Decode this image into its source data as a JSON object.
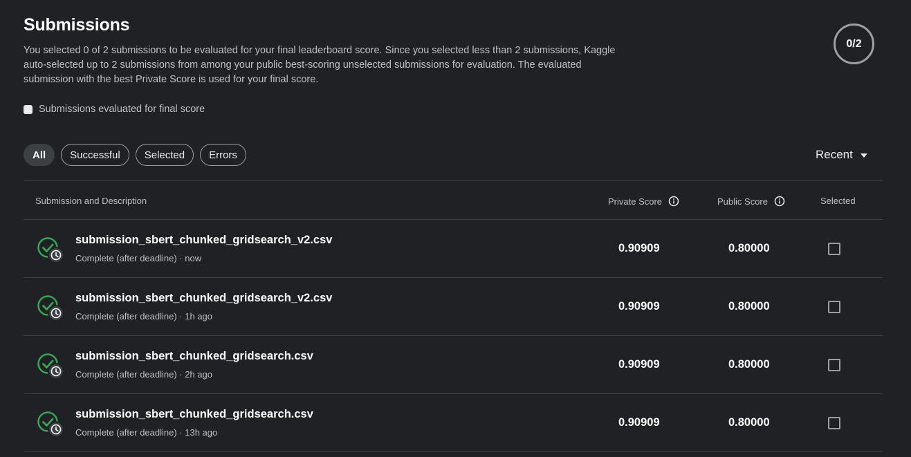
{
  "header": {
    "title": "Submissions",
    "description": "You selected 0 of 2 submissions to be evaluated for your final leaderboard score. Since you selected less than 2 submissions, Kaggle auto-selected up to 2 submissions from among your public best-scoring unselected submissions for evaluation. The evaluated submission with the best Private Score is used for your final score.",
    "counter": "0/2"
  },
  "legend": {
    "label": "Submissions evaluated for final score"
  },
  "filters": {
    "chips": [
      "All",
      "Successful",
      "Selected",
      "Errors"
    ],
    "active": "All"
  },
  "sort": {
    "label": "Recent"
  },
  "table": {
    "columns": {
      "submission": "Submission and Description",
      "private": "Private Score",
      "public": "Public Score",
      "selected": "Selected"
    },
    "rows": [
      {
        "filename": "submission_sbert_chunked_gridsearch_v2.csv",
        "status": "Complete (after deadline) · now",
        "private_score": "0.90909",
        "public_score": "0.80000",
        "selected": false
      },
      {
        "filename": "submission_sbert_chunked_gridsearch_v2.csv",
        "status": "Complete (after deadline) · 1h ago",
        "private_score": "0.90909",
        "public_score": "0.80000",
        "selected": false
      },
      {
        "filename": "submission_sbert_chunked_gridsearch.csv",
        "status": "Complete (after deadline) · 2h ago",
        "private_score": "0.90909",
        "public_score": "0.80000",
        "selected": false
      },
      {
        "filename": "submission_sbert_chunked_gridsearch.csv",
        "status": "Complete (after deadline) · 13h ago",
        "private_score": "0.90909",
        "public_score": "0.80000",
        "selected": false
      }
    ]
  },
  "icons": {
    "status": "check-circle-with-clock-icon",
    "info": "info-icon",
    "sort_caret": "caret-down-icon"
  },
  "colors": {
    "background": "#202124",
    "success": "#34a853",
    "text": "#ffffff",
    "muted": "#bdc1c6",
    "border": "#3c4043"
  }
}
